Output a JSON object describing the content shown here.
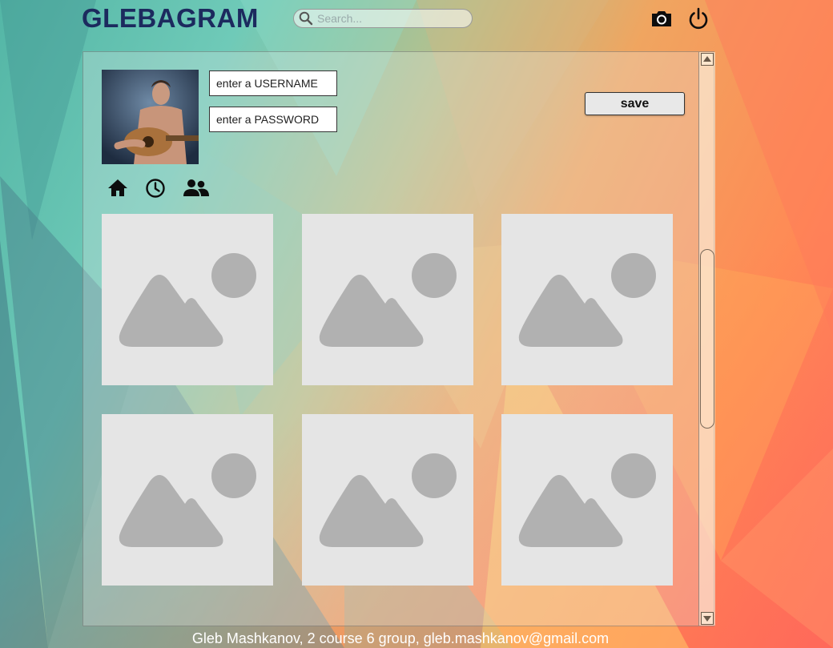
{
  "app": {
    "title": "GLEBAGRAM"
  },
  "search": {
    "placeholder": "Search..."
  },
  "header": {
    "camera_icon": "camera-icon",
    "power_icon": "power-icon"
  },
  "profile": {
    "username_placeholder": "enter a USERNAME",
    "password_placeholder": "enter a PASSWORD",
    "save_label": "save"
  },
  "nav": {
    "icons": [
      "home-icon",
      "clock-icon",
      "people-icon"
    ]
  },
  "gallery": {
    "count": 6,
    "placeholder_icon": "image-placeholder-icon"
  },
  "footer": {
    "text": "Gleb Mashkanov, 2 course 6 group, gleb.mashkanov@gmail.com"
  },
  "colors": {
    "logo": "#1c2a5e",
    "placeholder_bg": "#e5e5e5",
    "placeholder_shape": "#b1b1b1"
  }
}
